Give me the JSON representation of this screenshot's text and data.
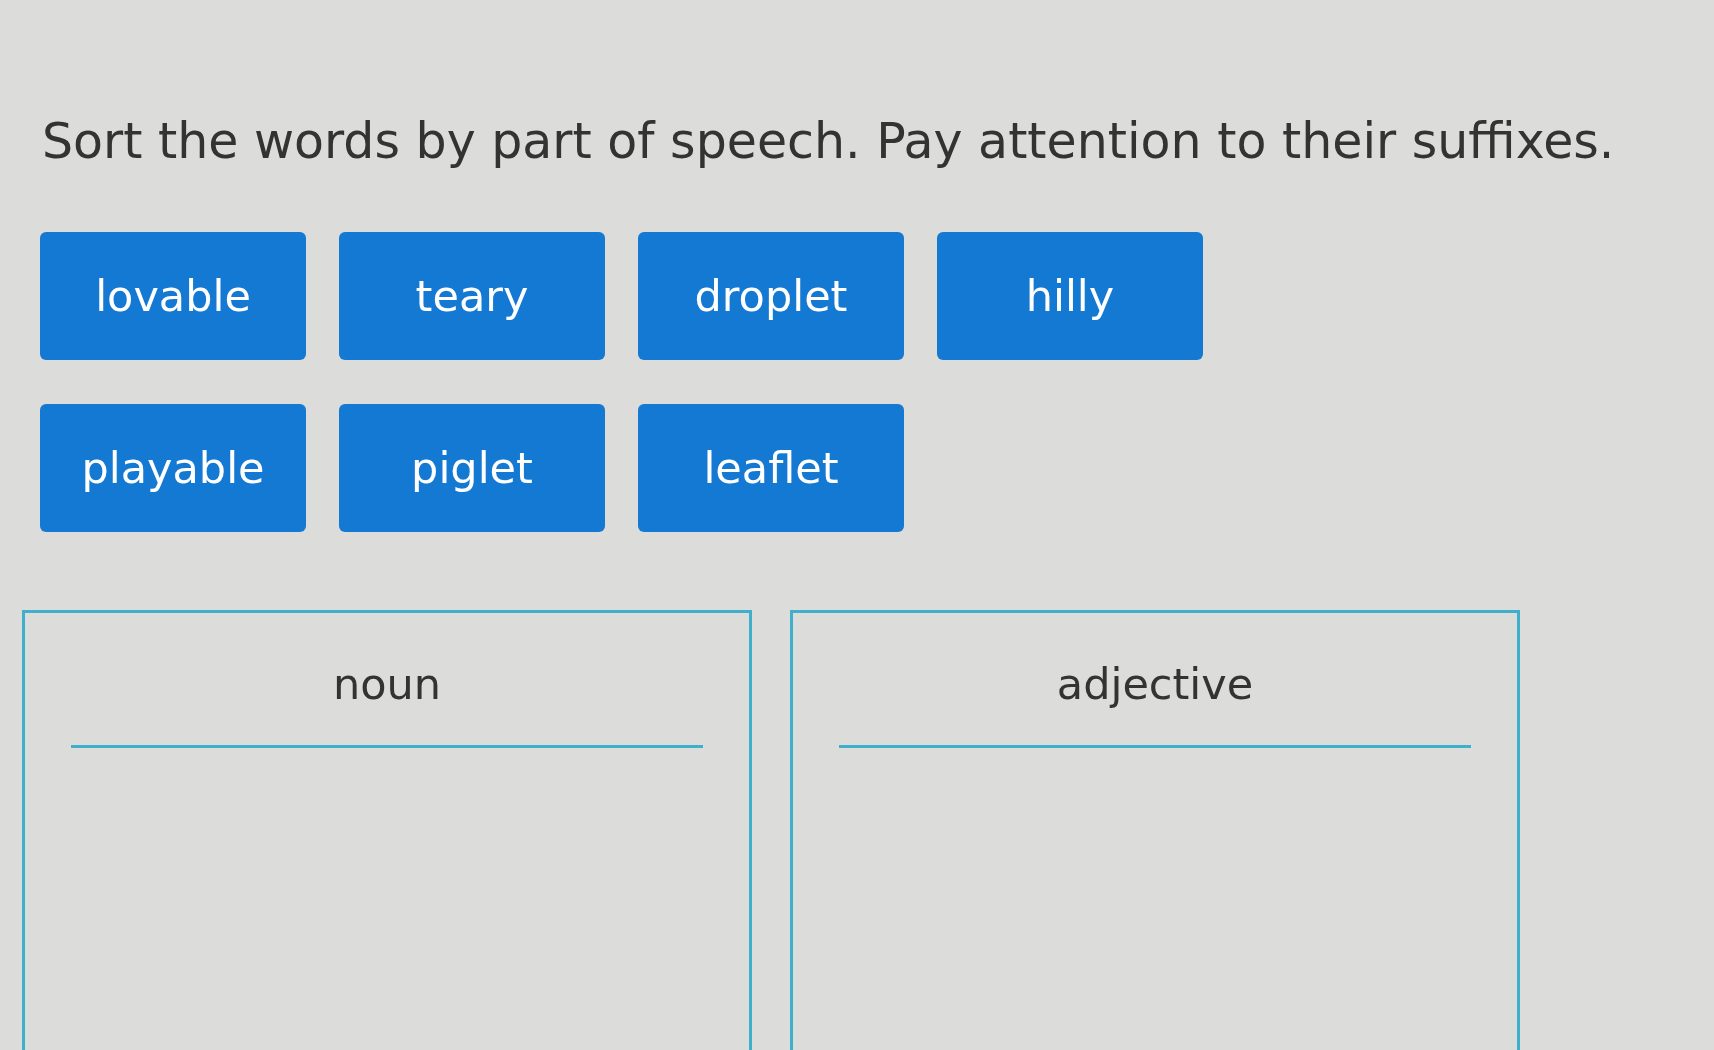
{
  "instruction": "Sort the words by part of speech. Pay attention to their suffixes.",
  "tile_rows": [
    [
      "lovable",
      "teary",
      "droplet",
      "hilly"
    ],
    [
      "playable",
      "piglet",
      "leaflet"
    ]
  ],
  "categories": [
    {
      "label": "noun"
    },
    {
      "label": "adjective"
    }
  ]
}
